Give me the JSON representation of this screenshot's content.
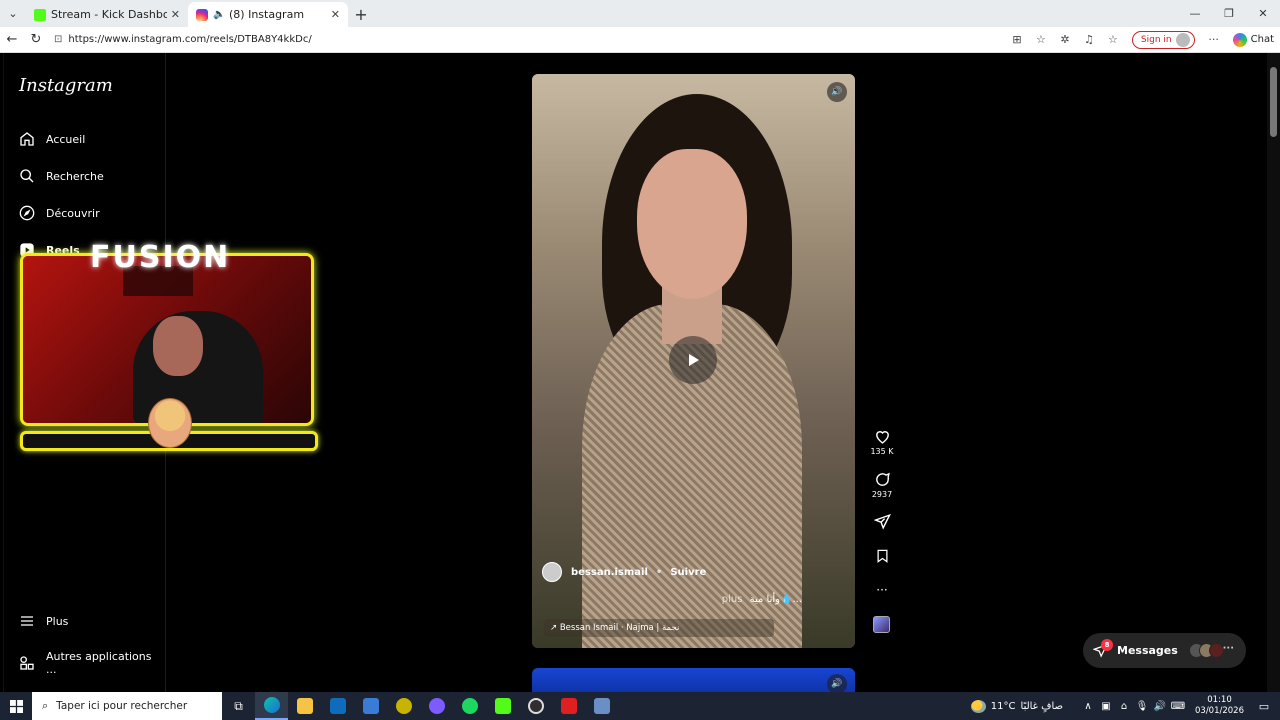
{
  "browser": {
    "tabs": [
      {
        "title": "Stream - Kick Dashboard",
        "active": false
      },
      {
        "title": "(8) Instagram",
        "active": true
      }
    ],
    "url": "https://www.instagram.com/reels/DTBA8Y4kkDc/",
    "sign_in": "Sign in",
    "chat": "Chat"
  },
  "instagram": {
    "logo": "Instagram",
    "nav": [
      {
        "label": "Accueil",
        "icon": "home-icon"
      },
      {
        "label": "Recherche",
        "icon": "search-icon"
      },
      {
        "label": "Découvrir",
        "icon": "compass-icon"
      },
      {
        "label": "Reels",
        "icon": "reels-icon"
      }
    ],
    "more": "Plus",
    "other_apps": "Autres applications ...",
    "reel": {
      "author": "bessan.ismail",
      "follow": "Suivre",
      "caption": "وأنا مية💧...",
      "more": "plus",
      "audio": "↗ Bessan Ismail · Najma | نجمة",
      "likes": "135 K",
      "comments": "2937"
    },
    "messages": {
      "label": "Messages",
      "badge": "8"
    }
  },
  "overlay": {
    "brand": "FUSION"
  },
  "taskbar": {
    "search_placeholder": "Taper ici pour rechercher",
    "weather_temp": "11°C",
    "weather_desc": "صافٍ غالبًا",
    "time": "01:10",
    "date": "03/01/2026"
  },
  "colors": {
    "accent_yellow": "#f5e81a",
    "like_red": "#ff3040",
    "taskbar": "#1c2433"
  }
}
